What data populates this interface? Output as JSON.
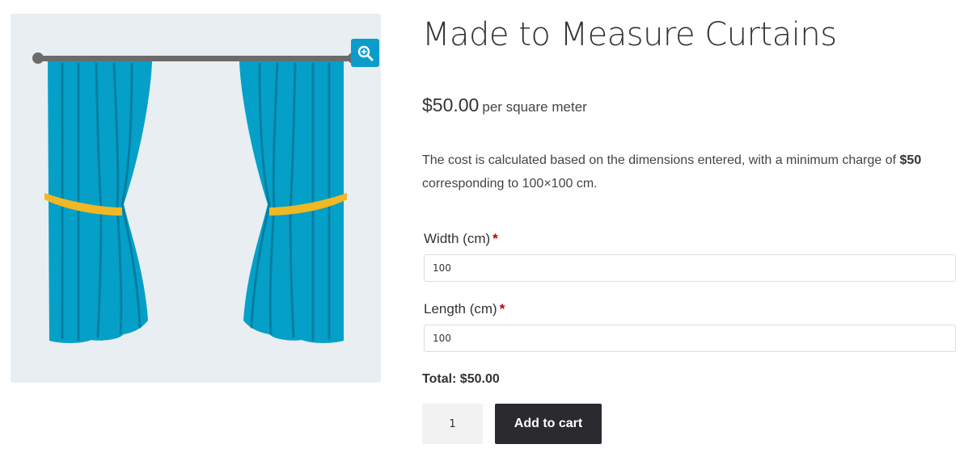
{
  "product": {
    "title": "Made to Measure Curtains",
    "price": "$50.00",
    "price_suffix": "per square meter",
    "description_prefix": "The cost is calculated based on the dimensions entered, with a minimum charge of ",
    "description_bold": "$50",
    "description_suffix": " corresponding to 100×100 cm.",
    "image_icon": "curtains-illustration",
    "zoom_icon": "magnifier-zoom-icon"
  },
  "form": {
    "width_label": "Width (cm)",
    "width_required": "*",
    "width_value": "100",
    "length_label": "Length (cm)",
    "length_required": "*",
    "length_value": "100",
    "total": "Total: $50.00"
  },
  "cart": {
    "quantity": "1",
    "add_to_cart_label": "Add to cart"
  },
  "colors": {
    "curtain": "#05a0c8",
    "curtain_fold": "#047fa1",
    "tieback": "#f0b824",
    "rod": "#6b6b6b",
    "zoom_button": "#0c9ccc",
    "button_dark": "#2b2b2f"
  }
}
